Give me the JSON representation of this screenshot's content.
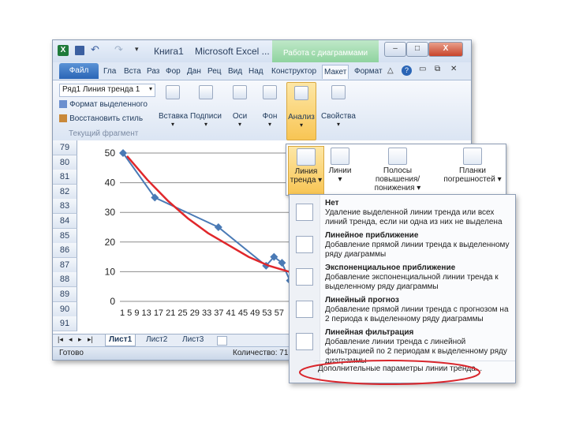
{
  "window": {
    "title_doc": "Книга1",
    "title_app": "Microsoft Excel ...",
    "context_tab": "Работа с диаграммами",
    "btn_min": "–",
    "btn_max": "□",
    "btn_close": "X"
  },
  "tabs": [
    "Гла",
    "Вста",
    "Раз",
    "Фор",
    "Дан",
    "Рец",
    "Вид",
    "Над",
    "Конструктор",
    "Макет",
    "Формат"
  ],
  "file_tab": "Файл",
  "ribbon": {
    "selection": "Ряд1 Линия тренда 1",
    "format_selection": "Формат выделенного",
    "reset_style": "Восстановить стиль",
    "current_fragment": "Текущий фрагмент",
    "groups": [
      "Вставка",
      "Подписи",
      "Оси",
      "Фон",
      "Анализ",
      "Свойства"
    ]
  },
  "rows": [
    "79",
    "80",
    "81",
    "82",
    "83",
    "84",
    "85",
    "86",
    "87",
    "88",
    "89",
    "90",
    "91"
  ],
  "sheet_tabs": [
    "Лист1",
    "Лист2",
    "Лист3"
  ],
  "status": {
    "ready": "Готово",
    "count": "Количество: 71"
  },
  "chart_data": {
    "type": "line",
    "ylim": [
      0,
      50
    ],
    "yticks": [
      "50",
      "40",
      "30",
      "20",
      "10",
      "0"
    ],
    "x": [
      1,
      9,
      25,
      37,
      39,
      41,
      43,
      45,
      47,
      49
    ],
    "xtick_text": "1 5 9 13 17 21 25 29 33 37 41 45 49 53 57",
    "series": [
      {
        "values": [
          50,
          35,
          25,
          12,
          15,
          13,
          7,
          10,
          6,
          8
        ]
      }
    ],
    "trend": [
      49,
      41,
      34,
      28,
      23,
      19,
      15,
      12,
      10,
      8,
      7
    ],
    "colors": {
      "series": "#4a7ab5",
      "trend": "#e0272b"
    }
  },
  "gallery": [
    {
      "label1": "Линия",
      "label2": "тренда"
    },
    {
      "label1": "Линии",
      "label2": ""
    },
    {
      "label1": "Полосы",
      "label2": "повышения/понижения"
    },
    {
      "label1": "Планки",
      "label2": "погрешностей"
    }
  ],
  "menu": [
    {
      "title": "Нет",
      "desc": "Удаление выделенной линии тренда или всех линий тренда, если ни одна из них не выделена"
    },
    {
      "title": "Линейное приближение",
      "desc": "Добавление прямой линии тренда к выделенному ряду диаграммы"
    },
    {
      "title": "Экспоненциальное приближение",
      "desc": "Добавление экспоненциальной линии тренда к выделенному ряду диаграммы"
    },
    {
      "title": "Линейный прогноз",
      "desc": "Добавление прямой линии тренда с прогнозом на 2 периода к выделенному ряду диаграммы"
    },
    {
      "title": "Линейная фильтрация",
      "desc": "Добавление линии тренда с линейной фильтрацией по 2 периодам к выделенному ряду диаграммы"
    }
  ],
  "menu_more": "Дополнительные параметры линии тренда...",
  "highlight_color": "#d9262c"
}
